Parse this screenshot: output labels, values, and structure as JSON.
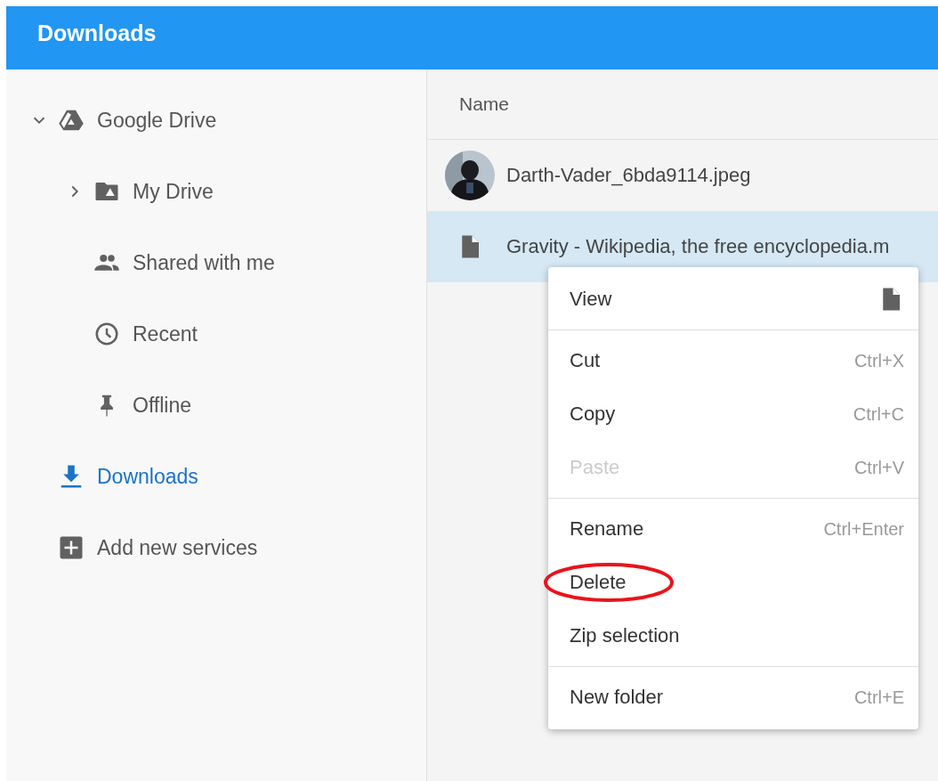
{
  "window": {
    "title": "Downloads"
  },
  "sidebar": {
    "items": [
      {
        "label": "Google Drive",
        "kind": "drive",
        "expanded": true,
        "selected": false,
        "children": [
          {
            "label": "My Drive",
            "kind": "drive-folder",
            "expanded": false,
            "selected": false
          },
          {
            "label": "Shared with me",
            "kind": "people",
            "selected": false
          },
          {
            "label": "Recent",
            "kind": "clock",
            "selected": false
          },
          {
            "label": "Offline",
            "kind": "pin",
            "selected": false
          }
        ]
      },
      {
        "label": "Downloads",
        "kind": "download",
        "selected": true
      },
      {
        "label": "Add new services",
        "kind": "add",
        "selected": false
      }
    ]
  },
  "table": {
    "columns": [
      "Name"
    ],
    "rows": [
      {
        "name": "Darth-Vader_6bda9114.jpeg",
        "kind": "picture",
        "selected": false
      },
      {
        "name": "Gravity - Wikipedia, the free encyclopedia.m",
        "kind": "file",
        "selected": true
      }
    ]
  },
  "context_menu": {
    "groups": [
      [
        {
          "label": "View",
          "kind": "file",
          "disabled": false,
          "circled": false
        }
      ],
      [
        {
          "label": "Cut",
          "shortcut": "Ctrl+X",
          "disabled": false,
          "circled": false
        },
        {
          "label": "Copy",
          "shortcut": "Ctrl+C",
          "disabled": false,
          "circled": false
        },
        {
          "label": "Paste",
          "shortcut": "Ctrl+V",
          "disabled": true,
          "circled": false
        }
      ],
      [
        {
          "label": "Rename",
          "shortcut": "Ctrl+Enter",
          "disabled": false,
          "circled": false
        },
        {
          "label": "Delete",
          "disabled": false,
          "circled": true
        },
        {
          "label": "Zip selection",
          "disabled": false,
          "circled": false
        }
      ],
      [
        {
          "label": "New folder",
          "shortcut": "Ctrl+E",
          "disabled": false,
          "circled": false
        }
      ]
    ]
  }
}
